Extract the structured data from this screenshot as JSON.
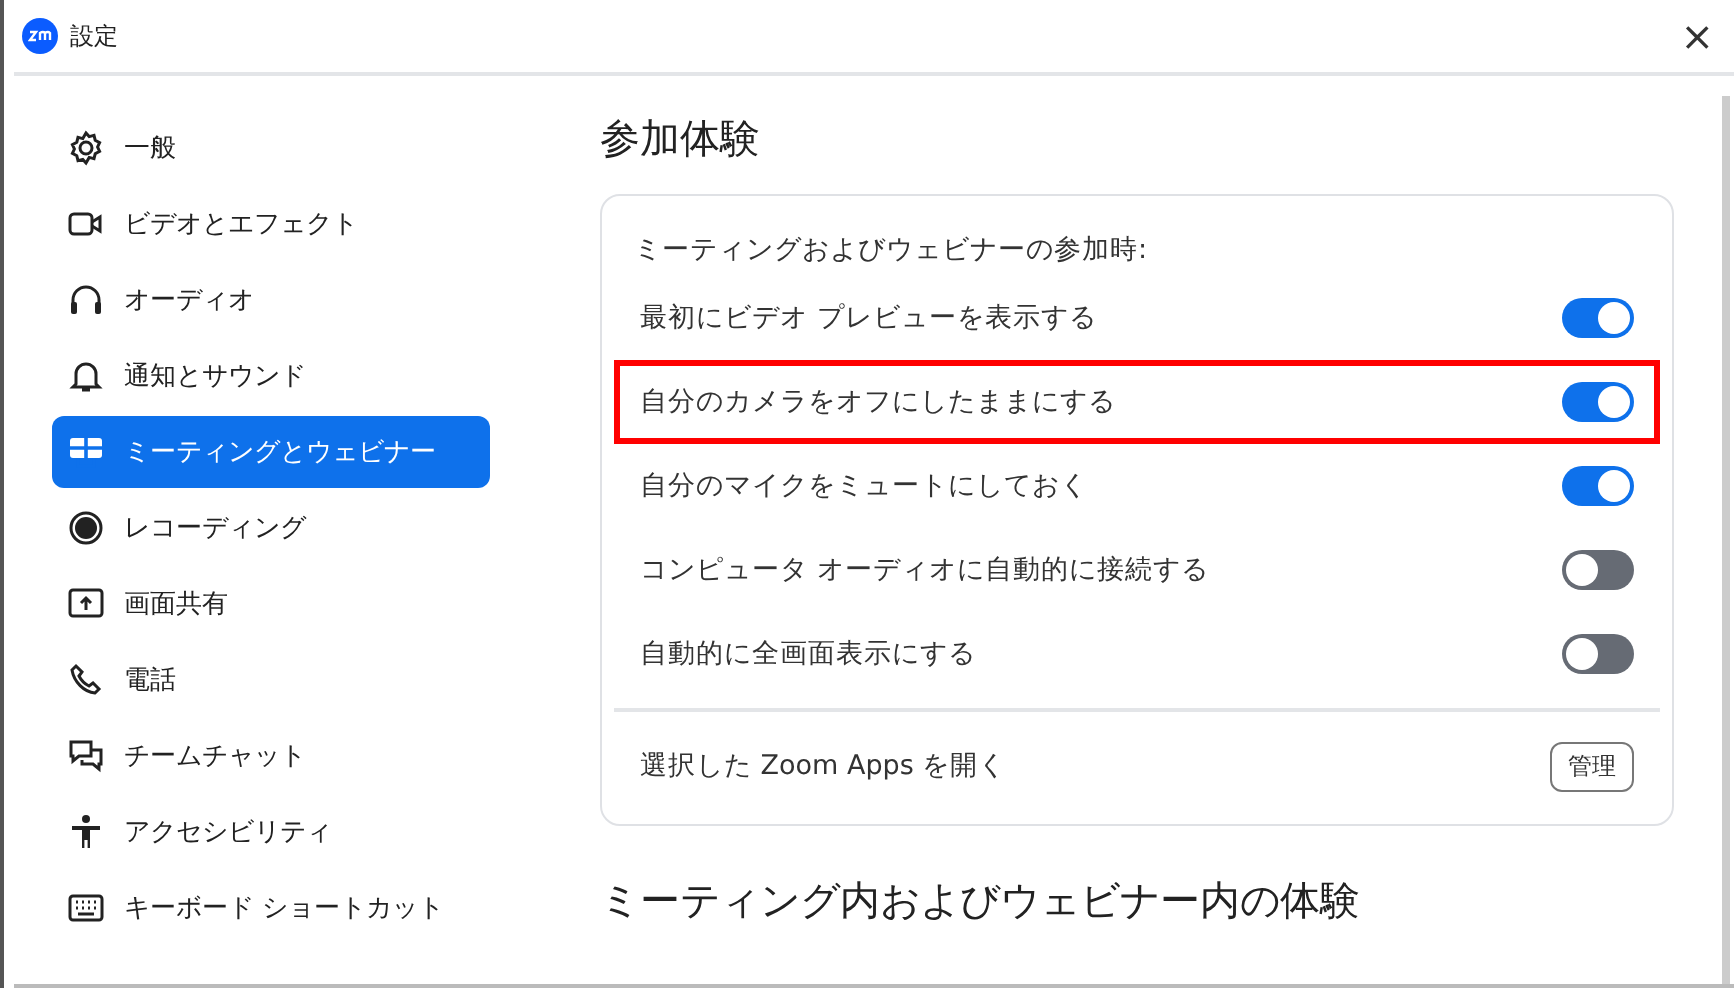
{
  "window": {
    "title": "設定",
    "close": "×"
  },
  "sidebar": {
    "items": [
      {
        "label": "一般",
        "selected": false
      },
      {
        "label": "ビデオとエフェクト",
        "selected": false
      },
      {
        "label": "オーディオ",
        "selected": false
      },
      {
        "label": "通知とサウンド",
        "selected": false
      },
      {
        "label": "ミーティングとウェビナー",
        "selected": true
      },
      {
        "label": "レコーディング",
        "selected": false
      },
      {
        "label": "画面共有",
        "selected": false
      },
      {
        "label": "電話",
        "selected": false
      },
      {
        "label": "チームチャット",
        "selected": false
      },
      {
        "label": "アクセシビリティ",
        "selected": false
      },
      {
        "label": "キーボード ショートカット",
        "selected": false
      }
    ]
  },
  "content": {
    "heading": "参加体験",
    "card": {
      "subheading": "ミーティングおよびウェビナーの参加時:",
      "toggles": [
        {
          "label": "最初にビデオ プレビューを表示する",
          "on": true,
          "highlighted": false
        },
        {
          "label": "自分のカメラをオフにしたままにする",
          "on": true,
          "highlighted": true
        },
        {
          "label": "自分のマイクをミュートにしておく",
          "on": true,
          "highlighted": false
        },
        {
          "label": "コンピュータ オーディオに自動的に接続する",
          "on": false,
          "highlighted": false
        },
        {
          "label": "自動的に全画面表示にする",
          "on": false,
          "highlighted": false
        }
      ],
      "apps_row": {
        "label": "選択した Zoom Apps を開く",
        "button": "管理"
      }
    },
    "next_heading": "ミーティング内およびウェビナー内の体験"
  }
}
